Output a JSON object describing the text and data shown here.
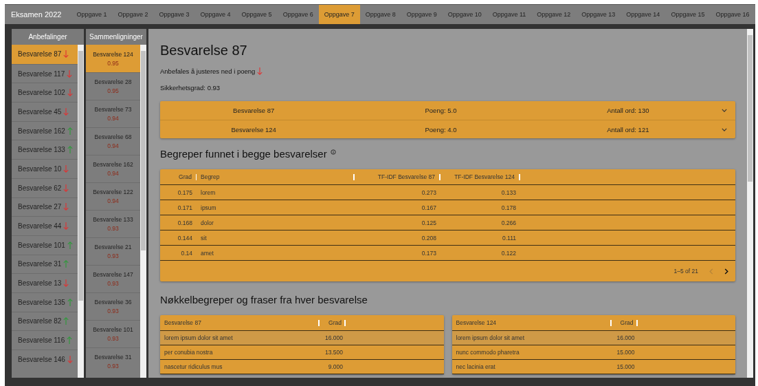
{
  "app_title": "Eksamen 2022",
  "tabs": [
    {
      "label": "Oppgave 1",
      "selected": false
    },
    {
      "label": "Oppgave 2",
      "selected": false
    },
    {
      "label": "Oppgave 3",
      "selected": false
    },
    {
      "label": "Oppgave 4",
      "selected": false
    },
    {
      "label": "Oppgave 5",
      "selected": false
    },
    {
      "label": "Oppgave 6",
      "selected": false
    },
    {
      "label": "Oppgave 7",
      "selected": true
    },
    {
      "label": "Oppgave 8",
      "selected": false
    },
    {
      "label": "Oppgave 9",
      "selected": false
    },
    {
      "label": "Oppgave 10",
      "selected": false
    },
    {
      "label": "Oppgave 11",
      "selected": false
    },
    {
      "label": "Oppgave 12",
      "selected": false
    },
    {
      "label": "Oppgave 13",
      "selected": false
    },
    {
      "label": "Oppgave 14",
      "selected": false
    },
    {
      "label": "Oppgave 15",
      "selected": false
    },
    {
      "label": "Oppgave 16",
      "selected": false
    }
  ],
  "recommendations": {
    "title": "Anbefalinger",
    "items": [
      {
        "label": "Besvarelse 87",
        "kind": "down",
        "selected": true
      },
      {
        "label": "Besvarelse 117",
        "kind": "down",
        "selected": false
      },
      {
        "label": "Besvarelse 102",
        "kind": "down",
        "selected": false
      },
      {
        "label": "Besvarelse 45",
        "kind": "down",
        "selected": false
      },
      {
        "label": "Besvarelse 162",
        "kind": "up",
        "selected": false
      },
      {
        "label": "Besvarelse 133",
        "kind": "up",
        "selected": false
      },
      {
        "label": "Besvarelse 10",
        "kind": "down",
        "selected": false
      },
      {
        "label": "Besvarelse 62",
        "kind": "down",
        "selected": false
      },
      {
        "label": "Besvarelse 27",
        "kind": "down",
        "selected": false
      },
      {
        "label": "Besvarelse 44",
        "kind": "down",
        "selected": false
      },
      {
        "label": "Besvarelse 101",
        "kind": "up",
        "selected": false
      },
      {
        "label": "Besvarelse 31",
        "kind": "up",
        "selected": false
      },
      {
        "label": "Besvarelse 13",
        "kind": "down",
        "selected": false
      },
      {
        "label": "Besvarelse 135",
        "kind": "up",
        "selected": false
      },
      {
        "label": "Besvarelse 82",
        "kind": "up",
        "selected": false
      },
      {
        "label": "Besvarelse 116",
        "kind": "up",
        "selected": false
      },
      {
        "label": "Besvarelse 146",
        "kind": "down",
        "selected": false
      }
    ]
  },
  "comparisons": {
    "title": "Sammenligninger",
    "items": [
      {
        "label": "Besvarelse 124",
        "score": "0.95",
        "selected": true
      },
      {
        "label": "Besvarelse 28",
        "score": "0.95",
        "selected": false
      },
      {
        "label": "Besvarelse 73",
        "score": "0.94",
        "selected": false
      },
      {
        "label": "Besvarelse 68",
        "score": "0.94",
        "selected": false
      },
      {
        "label": "Besvarelse 162",
        "score": "0.94",
        "selected": false
      },
      {
        "label": "Besvarelse 122",
        "score": "0.94",
        "selected": false
      },
      {
        "label": "Besvarelse 133",
        "score": "0.93",
        "selected": false
      },
      {
        "label": "Besvarelse 21",
        "score": "0.93",
        "selected": false
      },
      {
        "label": "Besvarelse 147",
        "score": "0.93",
        "selected": false
      },
      {
        "label": "Besvarelse 36",
        "score": "0.93",
        "selected": false
      },
      {
        "label": "Besvarelse 101",
        "score": "0.93",
        "selected": false
      },
      {
        "label": "Besvarelse 31",
        "score": "0.93",
        "selected": false
      }
    ]
  },
  "detail": {
    "title": "Besvarelse 87",
    "recommendation": "Anbefales å justeres ned i poeng",
    "kind": "down",
    "confidence": "Sikkerhetsgrad: 0.93",
    "answers": [
      {
        "name": "Besvarelse 87",
        "points": "Poeng: 5.0",
        "words": "Antall ord: 130"
      },
      {
        "name": "Besvarelse 124",
        "points": "Poeng: 4.0",
        "words": "Antall ord: 121"
      }
    ],
    "common_terms": {
      "title": "Begreper funnet i begge besvarelser",
      "columns": [
        "Grad",
        "Begrep",
        "TF-IDF Besvarelse 87",
        "TF-IDF Besvarelse 124"
      ],
      "rows": [
        [
          "0.175",
          "lorem",
          "0.273",
          "0.133"
        ],
        [
          "0.171",
          "ipsum",
          "0.167",
          "0.178"
        ],
        [
          "0.168",
          "dolor",
          "0.125",
          "0.266"
        ],
        [
          "0.144",
          "sit",
          "0.208",
          "0.111"
        ],
        [
          "0.14",
          "amet",
          "0.173",
          "0.122"
        ]
      ],
      "pagination": "1–5 of 21",
      "prev_disabled": true
    },
    "key_phrases": {
      "title": "Nøkkelbegreper og fraser fra hver besvarelse",
      "tables": [
        {
          "columns": [
            "Besvarelse 87",
            "Grad"
          ],
          "rows": [
            {
              "cells": [
                "lorem ipsum dolor sit amet",
                "16.000"
              ],
              "selected": true
            },
            {
              "cells": [
                "per conubia nostra",
                "13.500"
              ],
              "selected": false
            },
            {
              "cells": [
                "nascetur ridiculus mus",
                "9.000"
              ],
              "selected": false
            }
          ]
        },
        {
          "columns": [
            "Besvarelse 124",
            "Grad"
          ],
          "rows": [
            {
              "cells": [
                "lorem ipsum dolor sit amet",
                "16.000"
              ],
              "selected": true
            },
            {
              "cells": [
                "nunc commodo pharetra",
                "15.000"
              ],
              "selected": false
            },
            {
              "cells": [
                "nec lacinia erat",
                "15.000"
              ],
              "selected": false
            }
          ]
        }
      ]
    }
  }
}
